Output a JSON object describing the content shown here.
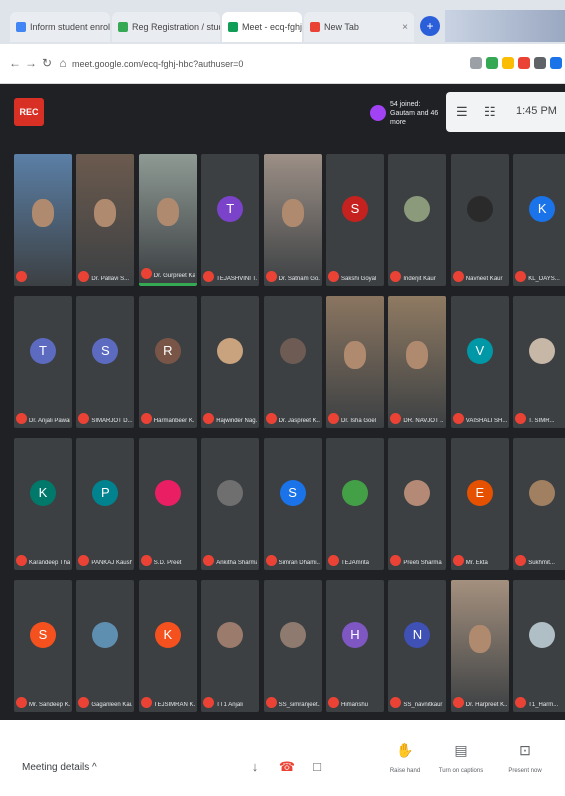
{
  "browser": {
    "tabs": [
      {
        "label": "Inform student enrolment...",
        "color": "#4285f4"
      },
      {
        "label": "Reg Registration / student con...",
        "color": "#34a853"
      },
      {
        "label": "Meet - ecq-fghj-hbc",
        "color": "#0f9d58",
        "active": true
      },
      {
        "label": "New Tab",
        "color": "#ea4335"
      }
    ],
    "new_tab_icon": "+",
    "url": "meet.google.com/ecq-fghj-hbc?authuser=0"
  },
  "meet": {
    "rec_label": "REC",
    "joined_text": "54 joined: Gautam and 46 more",
    "clock": "1:45 PM",
    "tiles": [
      {
        "name": "",
        "kind": "video",
        "bg": "#5b7fa6"
      },
      {
        "name": "Dr. Pallavi S...",
        "kind": "video",
        "bg": "#6b5a4e"
      },
      {
        "name": "Dr. Gurpreet Kau...",
        "kind": "video",
        "bg": "#8f9a94",
        "active": true
      },
      {
        "name": "TEJASHVINI T...",
        "kind": "avatar",
        "letter": "T",
        "color": "#7b43c9"
      },
      {
        "name": "Dr. Satnam Go...",
        "kind": "video",
        "bg": "#9c8f86"
      },
      {
        "name": "Sakshi Goyal",
        "kind": "avatar",
        "letter": "S",
        "color": "#c5221f"
      },
      {
        "name": "Inderjit Kaur",
        "kind": "photo",
        "color": "#8a9a7a"
      },
      {
        "name": "Navneet Kaur",
        "kind": "photo",
        "color": "#2a2a2a"
      },
      {
        "name": "KL_DAYS...",
        "kind": "avatar",
        "letter": "K",
        "color": "#1a73e8"
      },
      {
        "name": "Dr. Anjali Pawar",
        "kind": "avatar",
        "letter": "T",
        "color": "#5c6bc0"
      },
      {
        "name": "SIMARJOT D...",
        "kind": "avatar",
        "letter": "S",
        "color": "#5c6bc0"
      },
      {
        "name": "Harmanbeer K...",
        "kind": "avatar",
        "letter": "R",
        "color": "#795548"
      },
      {
        "name": "Rajwinder Nag...",
        "kind": "photo",
        "color": "#c9a27e"
      },
      {
        "name": "Dr. Jaspreet K...",
        "kind": "photo",
        "color": "#6d5b54"
      },
      {
        "name": "Dr. Isha Goel",
        "kind": "video",
        "bg": "#8a7560"
      },
      {
        "name": "DR. NAVJOT ...",
        "kind": "video",
        "bg": "#8f7a62"
      },
      {
        "name": "VAISHALI SH...",
        "kind": "avatar",
        "letter": "V",
        "color": "#0097a7"
      },
      {
        "name": "T. SIMR...",
        "kind": "photo",
        "color": "#c7b7a7"
      },
      {
        "name": "Karandeep Tha...",
        "kind": "avatar",
        "letter": "K",
        "color": "#00796b"
      },
      {
        "name": "PANKAJ Kaushal",
        "kind": "avatar",
        "letter": "P",
        "color": "#00838f"
      },
      {
        "name": "S.D. Preet",
        "kind": "photo",
        "color": "#e91e63"
      },
      {
        "name": "Ankitha Sharma",
        "kind": "photo",
        "color": "#6f6f6f"
      },
      {
        "name": "Simran Dhami...",
        "kind": "avatar",
        "letter": "S",
        "color": "#1a73e8"
      },
      {
        "name": "TEJAmrita",
        "kind": "photo",
        "color": "#43a047"
      },
      {
        "name": "Preeti Sharma",
        "kind": "photo",
        "color": "#b48a76"
      },
      {
        "name": "Mr. Ekta",
        "kind": "avatar",
        "letter": "E",
        "color": "#e65100"
      },
      {
        "name": "Sukhmit...",
        "kind": "photo",
        "color": "#a08060"
      },
      {
        "name": "Mr. Sandeep K...",
        "kind": "avatar",
        "letter": "S",
        "color": "#f4511e"
      },
      {
        "name": "Gaganleen Kaur",
        "kind": "photo",
        "color": "#5f8fb0"
      },
      {
        "name": "TEJSIMRAN K...",
        "kind": "avatar",
        "letter": "K",
        "color": "#f4511e"
      },
      {
        "name": "TT1 Anjali",
        "kind": "photo",
        "color": "#9b7b6b"
      },
      {
        "name": "SS_simranjeet...",
        "kind": "photo",
        "color": "#8e7a6e"
      },
      {
        "name": "Himanshu",
        "kind": "avatar",
        "letter": "H",
        "color": "#7e57c2"
      },
      {
        "name": "SS_navnitkaur K...",
        "kind": "avatar",
        "letter": "N",
        "color": "#3f51b5"
      },
      {
        "name": "Dr. Harpreet K...",
        "kind": "video",
        "bg": "#a4907e"
      },
      {
        "name": "T1_Harm...",
        "kind": "photo",
        "color": "#b0bec5"
      }
    ]
  },
  "bottom": {
    "details_label": "Meeting details  ^",
    "mic_icon": "↓",
    "end_icon": "☎",
    "cam_icon": "□",
    "raise_label": "Raise hand",
    "captions_label": "Turn on captions",
    "present_label": "Present now"
  }
}
